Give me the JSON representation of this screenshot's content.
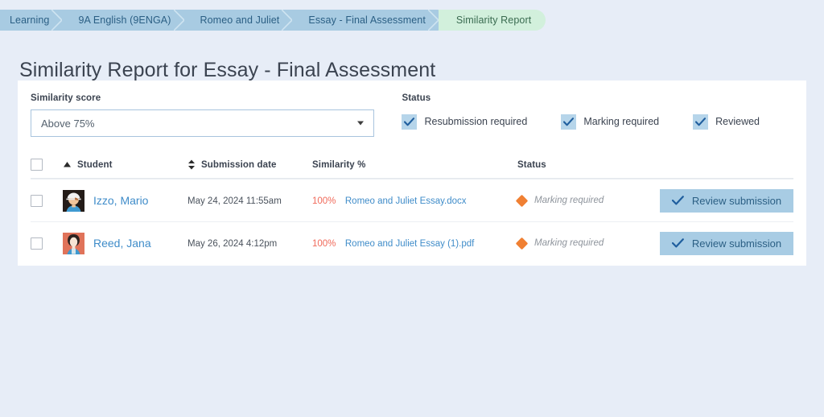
{
  "breadcrumb": {
    "items": [
      {
        "label": "Learning",
        "current": false
      },
      {
        "label": "9A English (9ENGA)",
        "current": false
      },
      {
        "label": "Romeo and Juliet",
        "current": false
      },
      {
        "label": "Essay - Final Assessment",
        "current": false
      },
      {
        "label": "Similarity Report",
        "current": true
      }
    ]
  },
  "page": {
    "title": "Similarity Report for Essay - Final Assessment"
  },
  "filters": {
    "score": {
      "label": "Similarity score",
      "value": "Above 75%",
      "options": [
        "Above 75%"
      ]
    },
    "status": {
      "label": "Status",
      "options": [
        {
          "label": "Resubmission required",
          "checked": true
        },
        {
          "label": "Marking required",
          "checked": true
        },
        {
          "label": "Reviewed",
          "checked": true
        }
      ]
    }
  },
  "table": {
    "headers": {
      "student": "Student",
      "submission_date": "Submission date",
      "similarity": "Similarity %",
      "status": "Status"
    },
    "sort": {
      "student": "ascending",
      "submission_date": "none"
    },
    "rows": [
      {
        "name": "Izzo, Mario",
        "date": "May 24, 2024 11:55am",
        "percent": "100%",
        "file": "Romeo and Juliet Essay.docx",
        "status": "Marking required",
        "action": "Review submission"
      },
      {
        "name": "Reed, Jana",
        "date": "May 26, 2024 4:12pm",
        "percent": "100%",
        "file": "Romeo and Juliet Essay (1).pdf",
        "status": "Marking required",
        "action": "Review submission"
      }
    ]
  },
  "colors": {
    "breadcrumb_bg": "#a8cbe2",
    "breadcrumb_current_bg": "#d2f0dc",
    "link": "#3f8cc9",
    "percent": "#f06a5a",
    "status_diamond": "#f08033",
    "button_bg": "#a8cce4",
    "page_bg": "#e7edf7"
  }
}
